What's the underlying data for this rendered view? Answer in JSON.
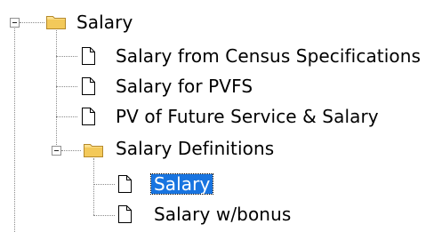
{
  "tree": {
    "root": {
      "label": "Salary",
      "icon": "folder-open-icon",
      "expanded": true,
      "children": [
        {
          "label": "Salary from Census Specifications",
          "icon": "document-icon"
        },
        {
          "label": "Salary for PVFS",
          "icon": "document-icon"
        },
        {
          "label": "PV of Future Service & Salary",
          "icon": "document-icon"
        },
        {
          "label": "Salary Definitions",
          "icon": "folder-open-icon",
          "expanded": true,
          "children": [
            {
              "label": "Salary",
              "icon": "document-icon",
              "selected": true
            },
            {
              "label": "Salary w/bonus",
              "icon": "document-icon"
            }
          ]
        }
      ]
    }
  },
  "colors": {
    "selection_background": "#1874e0",
    "selection_text": "#ffffff",
    "connector": "#8a8a8a",
    "folder": "#f3c95a"
  }
}
